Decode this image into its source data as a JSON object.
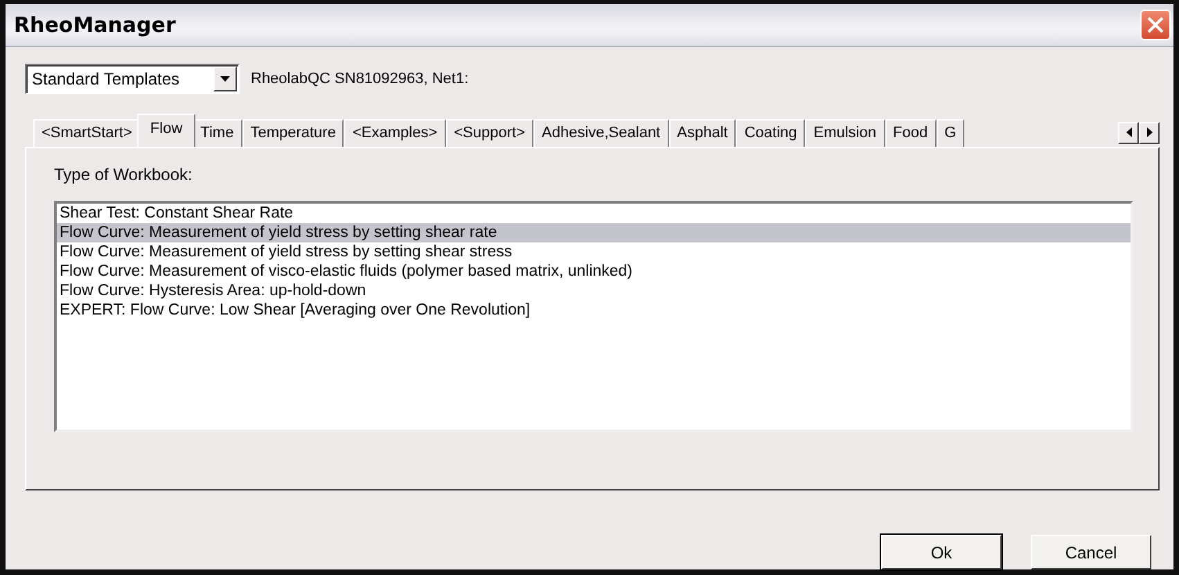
{
  "window": {
    "title": "RheoManager"
  },
  "template_select": {
    "value": "Standard Templates"
  },
  "device_label": "RheolabQC SN81092963, Net1:",
  "tabs": [
    {
      "label": "<SmartStart>",
      "selected": false
    },
    {
      "label": "Flow",
      "selected": true
    },
    {
      "label": "Time",
      "selected": false
    },
    {
      "label": "Temperature",
      "selected": false
    },
    {
      "label": "<Examples>",
      "selected": false
    },
    {
      "label": "<Support>",
      "selected": false
    },
    {
      "label": "Adhesive,Sealant",
      "selected": false
    },
    {
      "label": "Asphalt",
      "selected": false
    },
    {
      "label": "Coating",
      "selected": false
    },
    {
      "label": "Emulsion",
      "selected": false
    },
    {
      "label": "Food",
      "selected": false
    },
    {
      "label": "G",
      "selected": false
    }
  ],
  "list_label": "Type of Workbook:",
  "workbooks": [
    {
      "label": "Shear Test: Constant Shear Rate",
      "selected": false
    },
    {
      "label": "Flow Curve: Measurement of yield stress by setting shear rate",
      "selected": true
    },
    {
      "label": "Flow Curve: Measurement of yield stress by setting shear stress",
      "selected": false
    },
    {
      "label": "Flow Curve: Measurement of visco-elastic fluids (polymer based matrix, unlinked)",
      "selected": false
    },
    {
      "label": "Flow Curve: Hysteresis Area: up-hold-down",
      "selected": false
    },
    {
      "label": "EXPERT: Flow Curve: Low Shear [Averaging over One Revolution]",
      "selected": false
    }
  ],
  "buttons": [
    "Ok",
    "Cancel"
  ]
}
